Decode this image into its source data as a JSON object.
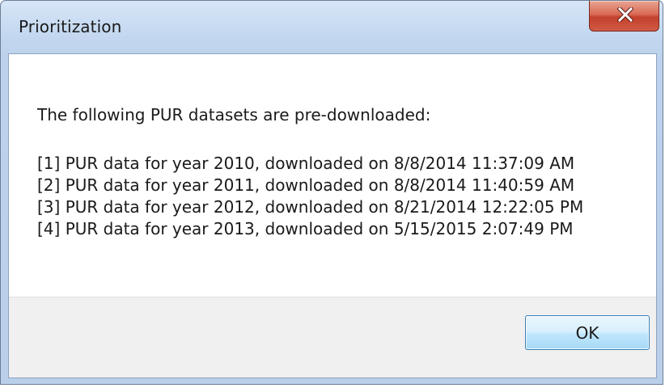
{
  "window": {
    "title": "Prioritization",
    "close_icon": "close-icon"
  },
  "message": {
    "intro": "The following PUR datasets are pre-downloaded:",
    "datasets": [
      "[1] PUR data for year 2010, downloaded on 8/8/2014 11:37:09 AM",
      "[2] PUR data for year 2011, downloaded on 8/8/2014 11:40:59 AM",
      "[3] PUR data for year 2012, downloaded on 8/21/2014 12:22:05 PM",
      "[4] PUR data for year 2013, downloaded on 5/15/2015 2:07:49 PM"
    ]
  },
  "buttons": {
    "ok_label": "OK"
  },
  "colors": {
    "frame": "#c4d8f0",
    "close_button": "#c4402c",
    "ok_button": "#bee6fd"
  }
}
